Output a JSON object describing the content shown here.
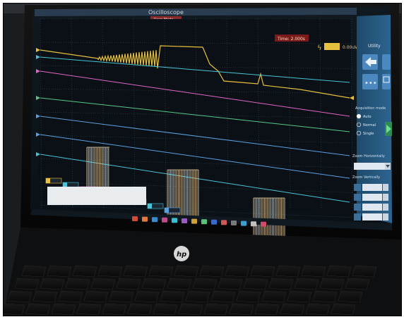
{
  "scope": {
    "title": "Oscilloscope",
    "subtitle": "Scan Mode",
    "time_label": "Time: 2.000s",
    "trigger_label": "0.00uV",
    "utility_label": "Utility",
    "acquisition": {
      "heading": "Acquisition mode",
      "options": [
        "Auto",
        "Normal",
        "Single"
      ],
      "selected": "Auto"
    },
    "zoom_horizontally_label": "Zoom Horizontally",
    "zoom_vertically_label": "Zoom Vertically"
  },
  "laptop": {
    "logo_text": "hp"
  },
  "colors": {
    "screen_bg": "#0a0f14",
    "grid": "#3a5566",
    "yellow_trace": "#e8c040",
    "cyan_trace": "#49c4d8",
    "magenta_trace": "#e066c8",
    "green_trace": "#58c88a",
    "blue_trace": "#5aa0e0",
    "pulse_trace": "#e0c9a0",
    "panel_bg": "#2a5a80"
  }
}
